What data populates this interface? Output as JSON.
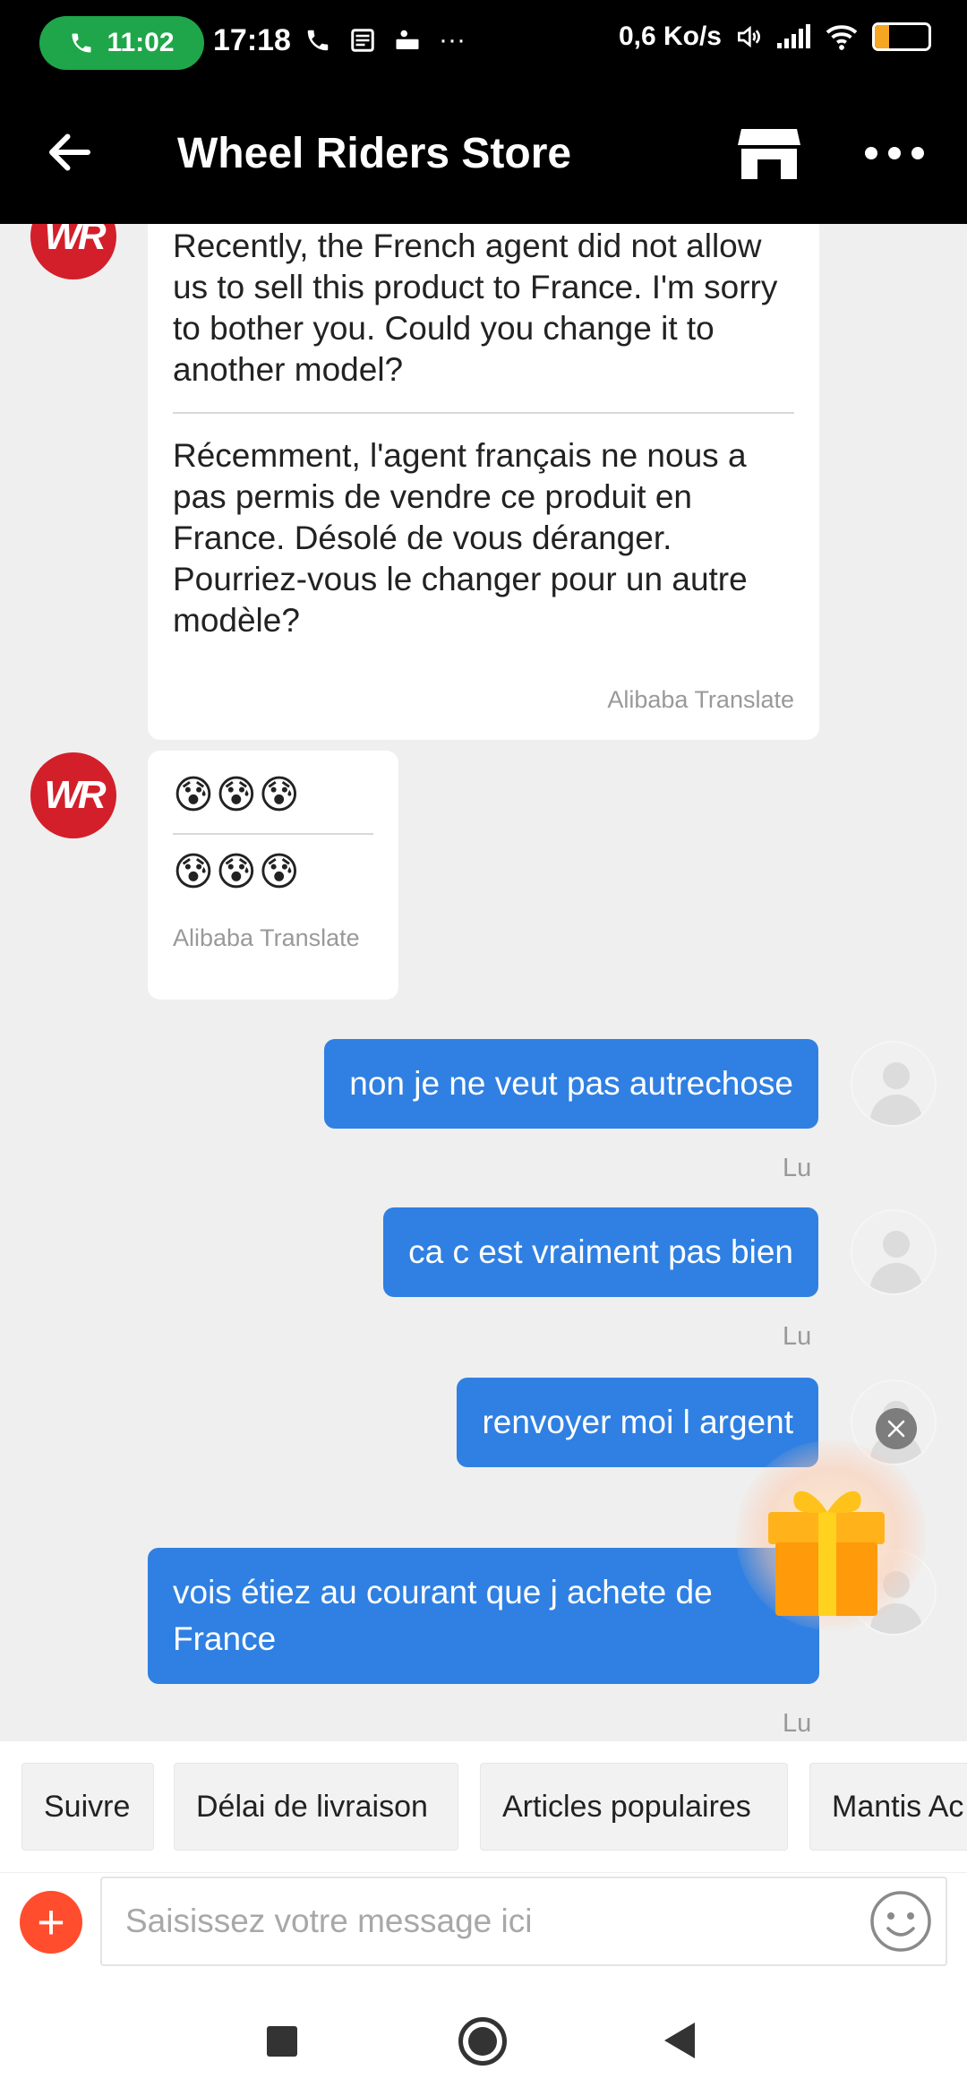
{
  "status_bar": {
    "call_time": "11:02",
    "time": "17:18",
    "net_speed": "0,6 Ko/s",
    "battery": "27",
    "battery_level": 0.27,
    "more": "···"
  },
  "header": {
    "title": "Wheel Riders Store"
  },
  "store": {
    "avatar_initials": "WR"
  },
  "messages": [
    {
      "from": "store",
      "original": "Recently, the French agent did not allow us to sell this product to France. I'm sorry to bother you. Could you change it to another model?",
      "translation": "Récemment, l'agent français ne nous a pas permis de vendre ce produit en France. Désolé de vous déranger. Pourriez-vous le changer pour un autre modèle?",
      "translated_by": "Alibaba Translate"
    },
    {
      "from": "store",
      "original": "😰😰😰",
      "translation": "😰😰😰",
      "translated_by": "Alibaba Translate"
    },
    {
      "from": "me",
      "text": "non je ne veut pas autrechose",
      "status": "Lu"
    },
    {
      "from": "me",
      "text": "ca c est vraiment pas bien",
      "status": "Lu"
    },
    {
      "from": "me",
      "text": "renvoyer moi l argent",
      "status": "Lu"
    },
    {
      "from": "me",
      "text": "vois étiez au courant que j achete de France",
      "status": "Lu"
    }
  ],
  "quick_replies": [
    "Suivre",
    "Délai de livraison",
    "Articles populaires",
    "Mantis Ac"
  ],
  "input": {
    "placeholder": "Saisissez votre message ici",
    "plus": "+"
  },
  "icons": {
    "back": "arrow-left-icon",
    "store": "store-icon",
    "more": "more-dots-icon",
    "gift": "gift-icon",
    "close": "close-icon",
    "smile": "smile-icon"
  },
  "colors": {
    "accent_blue": "#2f80e2",
    "brand_red": "#d31f2a",
    "plus_orange": "#ff4d2e",
    "call_green": "#1fa64a"
  }
}
